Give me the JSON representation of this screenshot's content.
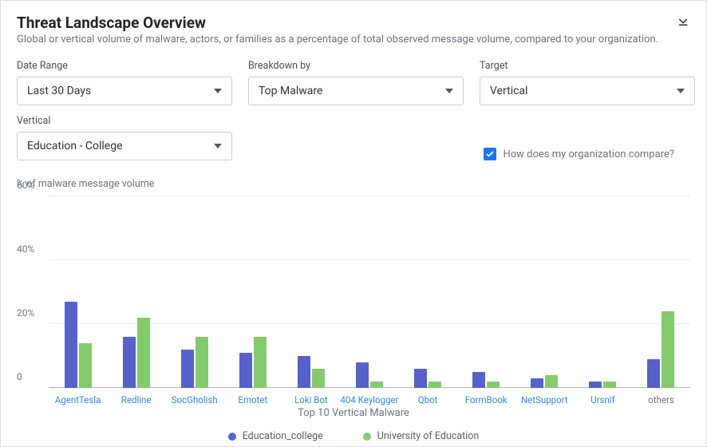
{
  "header": {
    "title": "Threat Landscape Overview",
    "subtitle": "Global or vertical volume of malware, actors, or families as a percentage of total observed message volume, compared to your organization."
  },
  "filters": {
    "date_range": {
      "label": "Date Range",
      "value": "Last 30 Days"
    },
    "breakdown": {
      "label": "Breakdown by",
      "value": "Top Malware"
    },
    "target": {
      "label": "Target",
      "value": "Vertical"
    },
    "vertical": {
      "label": "Vertical",
      "value": "Education - College"
    }
  },
  "compare": {
    "label": "How does my organization compare?",
    "checked": true
  },
  "chart_data": {
    "type": "bar",
    "y_label": "% of malware message volume",
    "x_title": "Top 10 Vertical Malware",
    "ylim": [
      0,
      60
    ],
    "ticks": [
      0,
      20,
      40,
      60
    ],
    "categories": [
      "AgentTesla",
      "Redline",
      "SocGholish",
      "Emotet",
      "Loki Bot",
      "404 Keylogger",
      "Qbot",
      "FormBook",
      "NetSupport",
      "Ursnif",
      "others"
    ],
    "series": [
      {
        "name": "Education_college",
        "color": "#5661c9",
        "values": [
          27,
          16,
          12,
          11,
          10,
          8,
          6,
          5,
          3,
          2,
          9
        ]
      },
      {
        "name": "University of Education",
        "color": "#83cb6c",
        "values": [
          14,
          22,
          16,
          16,
          6,
          2,
          2,
          2,
          4,
          2,
          24
        ]
      }
    ]
  }
}
